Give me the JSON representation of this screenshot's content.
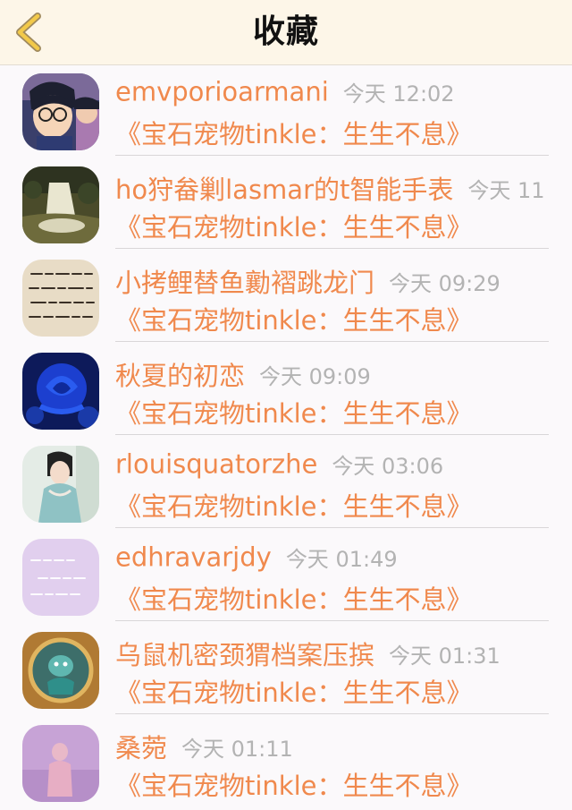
{
  "nav": {
    "title": "收藏",
    "back_icon": "chevron-left-icon",
    "accent": "#e8b83a"
  },
  "colors": {
    "name": "#f0894d",
    "time": "#b3b3b3",
    "background": "#fbf9fb"
  },
  "items": [
    {
      "name": "emvporioarmani",
      "time": "今天 12:02",
      "title": "《宝石宠物tinkle：生生不息》",
      "avatar": "anime-boy-avatar"
    },
    {
      "name": "ho狩畚剿lasmar的t智能手表",
      "time": "今天 11",
      "title": "《宝石宠物tinkle：生生不息》",
      "avatar": "waterfall-avatar"
    },
    {
      "name": "小拷鲤替鱼勷褶跳龙门",
      "time": "今天 09:29",
      "title": "《宝石宠物tinkle：生生不息》",
      "avatar": "handwriting-avatar"
    },
    {
      "name": "秋夏的初恋",
      "time": "今天 09:09",
      "title": "《宝石宠物tinkle：生生不息》",
      "avatar": "blue-rose-avatar"
    },
    {
      "name": "rlouisquatorzhe",
      "time": "今天 03:06",
      "title": "《宝石宠物tinkle：生生不息》",
      "avatar": "costume-girl-avatar"
    },
    {
      "name": "edhravarjdy",
      "time": "今天 01:49",
      "title": "《宝石宠物tinkle：生生不息》",
      "avatar": "purple-text-avatar"
    },
    {
      "name": "乌鼠机密颈猬档案压摈",
      "time": "今天 01:31",
      "title": "《宝石宠物tinkle：生生不息》",
      "avatar": "fantasy-creature-avatar"
    },
    {
      "name": "桑菀",
      "time": "今天 01:11",
      "title": "《宝石宠物tinkle：生生不息》",
      "avatar": "pink-figure-avatar"
    }
  ]
}
